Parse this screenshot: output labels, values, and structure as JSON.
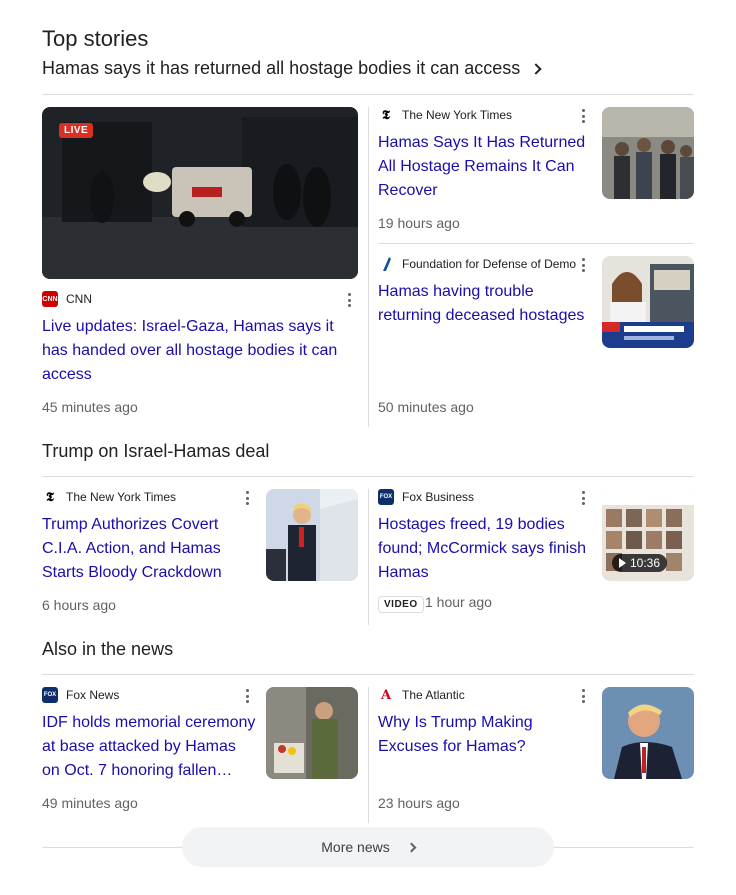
{
  "top_stories": {
    "title": "Top stories",
    "headline": "Hamas says it has returned all hostage bodies it can access",
    "main": {
      "badge": "LIVE",
      "source": "CNN",
      "favicon_text": "CNN",
      "favicon_color": "#cc0000",
      "title": "Live updates: Israel-Gaza, Hamas says it has handed over all hostage bodies it can access",
      "time": "45 minutes ago"
    },
    "side": [
      {
        "source": "The New York Times",
        "favicon_text": "𝕿",
        "title": "Hamas Says It Has Returned All Hostage Remains It Can Recover",
        "time": "19 hours ago"
      },
      {
        "source": "Foundation for Defense of Demo",
        "favicon_text": "",
        "title": "Hamas having trouble returning deceased hostages",
        "time": "50 minutes ago"
      }
    ]
  },
  "trump_section": {
    "title": "Trump on Israel-Hamas deal",
    "items": [
      {
        "source": "The New York Times",
        "favicon_text": "𝕿",
        "title": "Trump Authorizes Covert C.I.A. Action, and Hamas Starts Bloody Crackdown",
        "time": "6 hours ago"
      },
      {
        "source": "Fox Business",
        "favicon_text": "FOX",
        "title": "Hostages freed, 19 bodies found; McCormick says finish Hamas",
        "badge": "VIDEO",
        "time": "1 hour ago",
        "duration": "10:36"
      }
    ]
  },
  "also_section": {
    "title": "Also in the news",
    "items": [
      {
        "source": "Fox News",
        "favicon_text": "FOX",
        "title": "IDF holds memorial ceremony at base attacked by Hamas on Oct. 7 honoring fallen soldiers",
        "time": "49 minutes ago"
      },
      {
        "source": "The Atlantic",
        "favicon_text": "A",
        "title": "Why Is Trump Making Excuses for Hamas?",
        "time": "23 hours ago"
      }
    ]
  },
  "more_news": "More news"
}
